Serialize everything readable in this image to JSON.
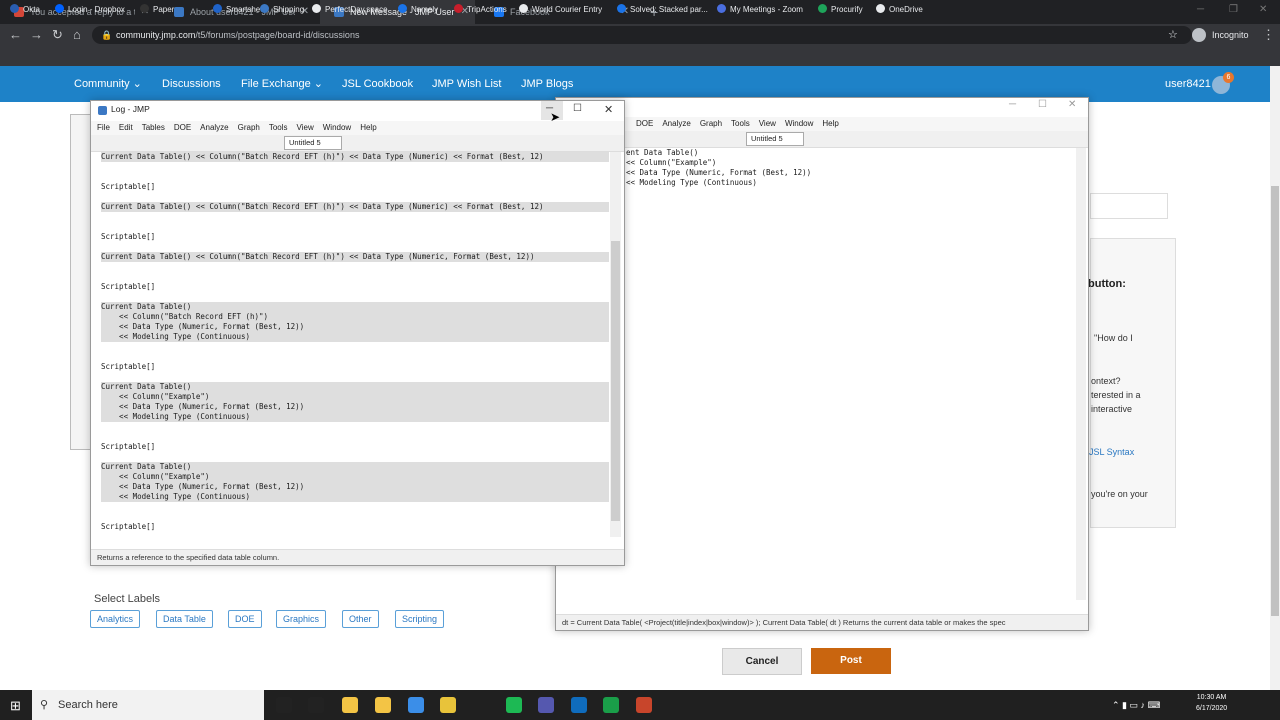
{
  "browser": {
    "tabs": [
      {
        "title": "You accepted a reply to a topic",
        "icon_color": "#d44638"
      },
      {
        "title": "About user8421 - JMP User Com",
        "icon_color": "#3b78c4"
      },
      {
        "title": "New Message - JMP User Comm",
        "icon_color": "#3b78c4"
      },
      {
        "title": "Facebook",
        "icon_color": "#1877f2"
      }
    ],
    "new_tab": "+",
    "url_host": "community.jmp.com",
    "url_path": "/t5/forums/postpage/board-id/discussions",
    "incognito_label": "Incognito",
    "bookmarks": [
      "Okta",
      "Login - Dropbox",
      "Paper",
      "Smartsheet",
      "Shipping",
      "PerfectDay.space",
      "Namely",
      "TripActions",
      "World Courier Entry",
      "Solved: Stacked par...",
      "My Meetings - Zoom",
      "Procurify",
      "OneDrive"
    ]
  },
  "community_nav": {
    "items": [
      "Community ⌄",
      "Discussions",
      "File Exchange ⌄",
      "JSL Cookbook",
      "JMP Wish List",
      "JMP Blogs"
    ],
    "user": "user8421",
    "badge": "6"
  },
  "page": {
    "side_text": [
      "button:",
      "\"How do I",
      "ontext?",
      "terested in a",
      "interactive",
      "JSL Syntax",
      "you're on your"
    ],
    "select_labels_title": "Select Labels",
    "labels": [
      "Analytics",
      "Data Table",
      "DOE",
      "Graphics",
      "Other",
      "Scripting"
    ],
    "cancel": "Cancel",
    "post": "Post"
  },
  "log_window": {
    "title": "Log - JMP",
    "menu": [
      "File",
      "Edit",
      "Tables",
      "DOE",
      "Analyze",
      "Graph",
      "Tools",
      "View",
      "Window",
      "Help"
    ],
    "dropdown": "Untitled 5",
    "lines": [
      {
        "text": "Current Data Table() << Column(\"Batch Record EFT (h)\") << Data Type (Numeric) << Format (Best, 12)",
        "hl": true
      },
      {
        "text": "",
        "hl": false
      },
      {
        "text": "",
        "hl": false
      },
      {
        "text": "Scriptable[]",
        "hl": false
      },
      {
        "text": "",
        "hl": false
      },
      {
        "text": "Current Data Table() << Column(\"Batch Record EFT (h)\") << Data Type (Numeric) << Format (Best, 12)",
        "hl": true
      },
      {
        "text": "",
        "hl": false
      },
      {
        "text": "",
        "hl": false
      },
      {
        "text": "Scriptable[]",
        "hl": false
      },
      {
        "text": "",
        "hl": false
      },
      {
        "text": "Current Data Table() << Column(\"Batch Record EFT (h)\") << Data Type (Numeric, Format (Best, 12))",
        "hl": true
      },
      {
        "text": "",
        "hl": false
      },
      {
        "text": "",
        "hl": false
      },
      {
        "text": "Scriptable[]",
        "hl": false
      },
      {
        "text": "",
        "hl": false
      },
      {
        "text": "Current Data Table()",
        "hl": true
      },
      {
        "text": "    << Column(\"Batch Record EFT (h)\")",
        "hl": true
      },
      {
        "text": "    << Data Type (Numeric, Format (Best, 12))",
        "hl": true
      },
      {
        "text": "    << Modeling Type (Continuous)",
        "hl": true
      },
      {
        "text": "",
        "hl": false
      },
      {
        "text": "",
        "hl": false
      },
      {
        "text": "Scriptable[]",
        "hl": false
      },
      {
        "text": "",
        "hl": false
      },
      {
        "text": "Current Data Table()",
        "hl": true
      },
      {
        "text": "    << Column(\"Example\")",
        "hl": true
      },
      {
        "text": "    << Data Type (Numeric, Format (Best, 12))",
        "hl": true
      },
      {
        "text": "    << Modeling Type (Continuous)",
        "hl": true
      },
      {
        "text": "",
        "hl": false
      },
      {
        "text": "",
        "hl": false
      },
      {
        "text": "Scriptable[]",
        "hl": false
      },
      {
        "text": "",
        "hl": false
      },
      {
        "text": "Current Data Table()",
        "hl": true
      },
      {
        "text": "    << Column(\"Example\")",
        "hl": true
      },
      {
        "text": "    << Data Type (Numeric, Format (Best, 12))",
        "hl": true
      },
      {
        "text": "    << Modeling Type (Continuous)",
        "hl": true
      },
      {
        "text": "",
        "hl": false
      },
      {
        "text": "",
        "hl": false
      },
      {
        "text": "Scriptable[]",
        "hl": false
      }
    ],
    "status": "Returns a reference to the specified data table column."
  },
  "script_window": {
    "menu": [
      "DOE",
      "Analyze",
      "Graph",
      "Tools",
      "View",
      "Window",
      "Help"
    ],
    "dropdown": "Untitled 5",
    "lines": [
      "ent Data Table()",
      "<< Column(\"Example\")",
      "<< Data Type (Numeric, Format (Best, 12))",
      "<< Modeling Type (Continuous)"
    ],
    "status": "dt = Current Data Table( <Project(title|index|box|window)> ); Current Data Table( dt )  Returns the current data table or makes the spec"
  },
  "taskbar": {
    "search_placeholder": "Search here",
    "time": "10:30 AM",
    "date": "6/17/2020"
  }
}
